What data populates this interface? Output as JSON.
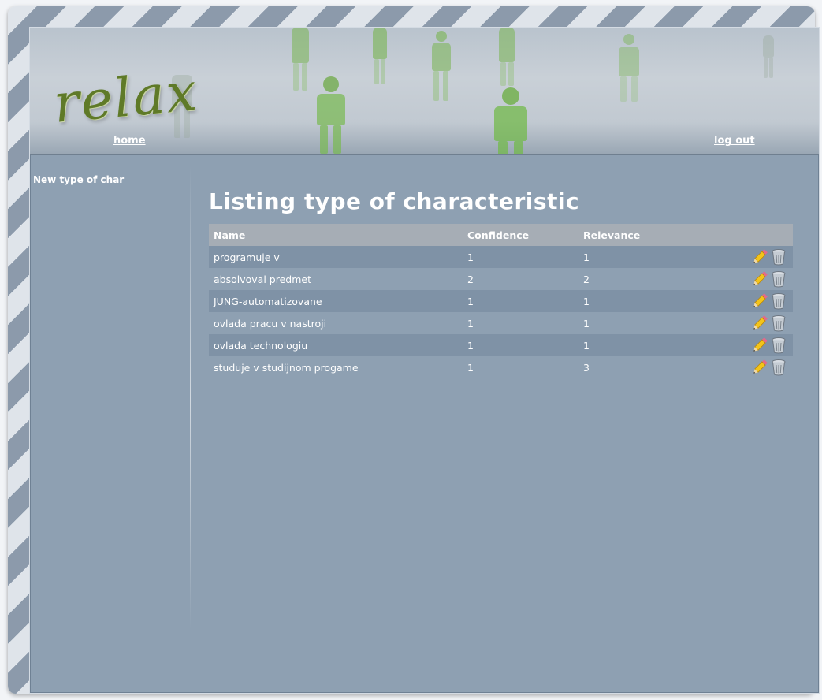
{
  "header": {
    "logo_text": "relax",
    "home_label": "home",
    "logout_label": "log out"
  },
  "sidebar": {
    "new_link_label": "New type of char"
  },
  "main": {
    "title": "Listing type of characteristic",
    "columns": [
      "Name",
      "Confidence",
      "Relevance",
      ""
    ],
    "rows": [
      {
        "name": "programuje v",
        "confidence": "1",
        "relevance": "1"
      },
      {
        "name": "absolvoval predmet",
        "confidence": "2",
        "relevance": "2"
      },
      {
        "name": "JUNG-automatizovane",
        "confidence": "1",
        "relevance": "1"
      },
      {
        "name": "ovlada pracu v nastroji",
        "confidence": "1",
        "relevance": "1"
      },
      {
        "name": "ovlada technologiu",
        "confidence": "1",
        "relevance": "1"
      },
      {
        "name": "studuje v studijnom progame",
        "confidence": "1",
        "relevance": "3"
      }
    ],
    "row_actions": [
      "pencil-icon",
      "trash-icon"
    ]
  },
  "colors": {
    "background": "#8ea0b2",
    "row_dark": "#7f92a6",
    "header_row": "#a6adb5",
    "logo_green": "#5f7a28"
  }
}
